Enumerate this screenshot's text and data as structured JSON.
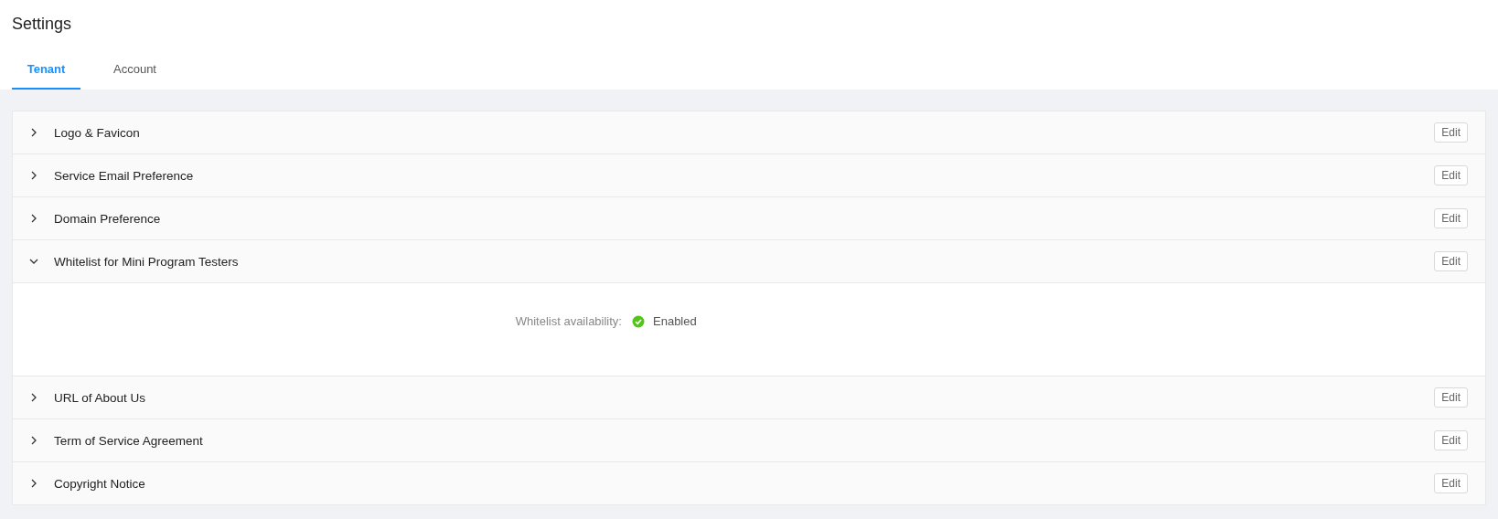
{
  "page": {
    "title": "Settings"
  },
  "tabs": [
    {
      "label": "Tenant",
      "selected": true
    },
    {
      "label": "Account",
      "selected": false
    }
  ],
  "sections": [
    {
      "title": "Logo & Favicon",
      "expanded": false,
      "action": "Edit"
    },
    {
      "title": "Service Email Preference",
      "expanded": false,
      "action": "Edit"
    },
    {
      "title": "Domain Preference",
      "expanded": false,
      "action": "Edit"
    },
    {
      "title": "Whitelist for Mini Program Testers",
      "expanded": true,
      "action": "Edit",
      "fields": [
        {
          "label": "Whitelist availability:",
          "value": "Enabled",
          "enabled": true
        }
      ]
    },
    {
      "title": "URL of About Us",
      "expanded": false,
      "action": "Edit"
    },
    {
      "title": "Term of Service Agreement",
      "expanded": false,
      "action": "Edit"
    },
    {
      "title": "Copyright Notice",
      "expanded": false,
      "action": "Edit"
    }
  ]
}
